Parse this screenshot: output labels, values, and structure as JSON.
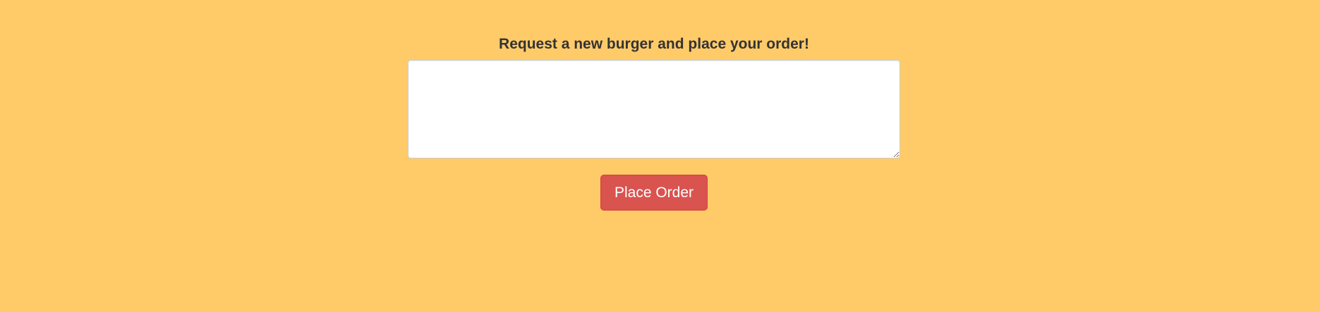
{
  "order_form": {
    "label": "Request a new burger and place your order!",
    "textarea_value": "",
    "submit_label": "Place Order"
  },
  "colors": {
    "background": "#ffcb69",
    "button": "#d9534f",
    "label_text": "#333333"
  }
}
